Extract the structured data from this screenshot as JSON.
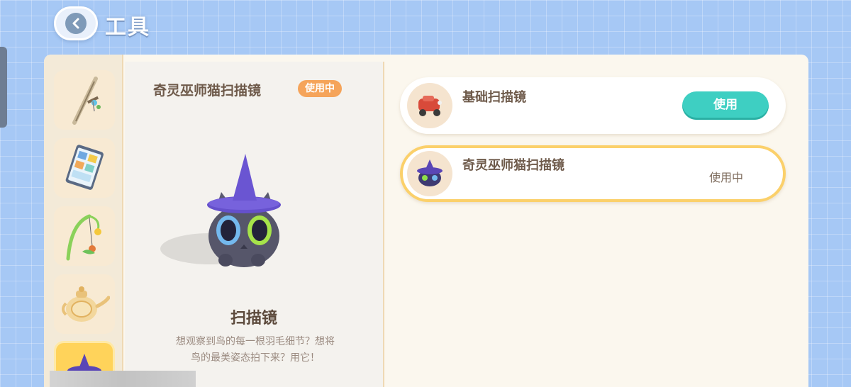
{
  "header": {
    "title": "工具",
    "back_icon": "chevron-left-icon"
  },
  "sidebar": {
    "items": [
      {
        "icon": "sword-icon",
        "active": false
      },
      {
        "icon": "tablet-icon",
        "active": false
      },
      {
        "icon": "fishing-rod-icon",
        "active": false
      },
      {
        "icon": "teapot-icon",
        "active": false
      },
      {
        "icon": "wizard-cat-scanner-icon",
        "active": true
      }
    ]
  },
  "detail": {
    "name": "奇灵巫师猫扫描镜",
    "badge": "使用中",
    "type_label": "扫描镜",
    "description_line1": "想观察到鸟的每一根羽毛细节？想将",
    "description_line2": "鸟的最美姿态拍下来？用它！"
  },
  "list": {
    "items": [
      {
        "name": "基础扫描镜",
        "icon": "red-car-scanner-icon",
        "action": "使用",
        "selected": false
      },
      {
        "name": "奇灵巫师猫扫描镜",
        "icon": "wizard-cat-scanner-icon",
        "status": "使用中",
        "selected": true
      }
    ]
  },
  "colors": {
    "background": "#a6c8f5",
    "accent_teal": "#3ecfc2",
    "badge_orange": "#f5a45a",
    "selected_border": "#fbd06a"
  }
}
